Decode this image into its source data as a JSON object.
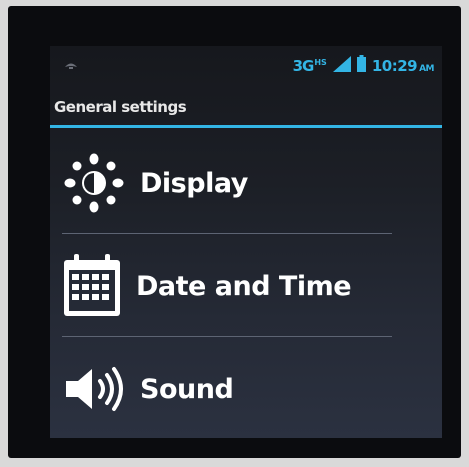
{
  "status_bar": {
    "network_type": "3G",
    "network_superscript": "HS",
    "time": "10:29",
    "ampm": "AM",
    "accent_color": "#33b5e5"
  },
  "header": {
    "title": "General settings"
  },
  "settings": [
    {
      "label": "Display",
      "icon": "sun-brightness-icon"
    },
    {
      "label": "Date and Time",
      "icon": "calendar-icon"
    },
    {
      "label": "Sound",
      "icon": "speaker-icon"
    }
  ]
}
